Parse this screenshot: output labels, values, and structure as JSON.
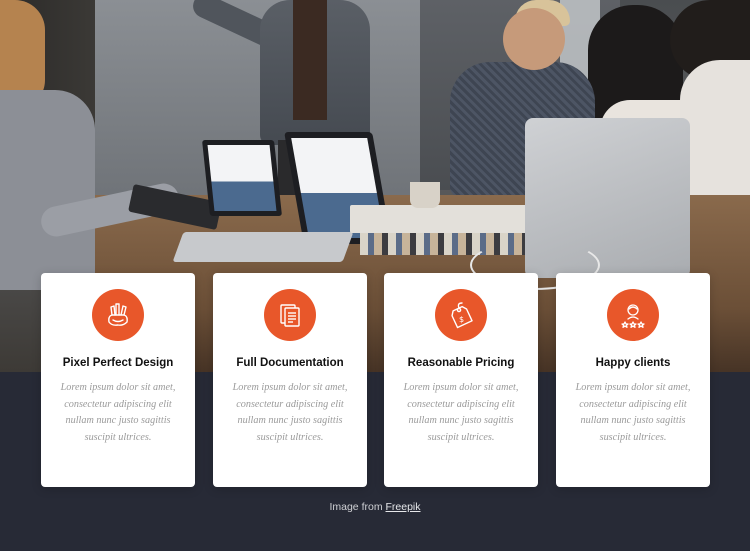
{
  "hero": {
    "icon": "meeting-photo"
  },
  "features": {
    "accent_color": "#e8572a",
    "items": [
      {
        "icon": "hand-pens-icon",
        "title": "Pixel Perfect Design",
        "text": "Lorem ipsum dolor sit amet, consectetur adipiscing elit nullam nunc justo sagittis suscipit ultrices."
      },
      {
        "icon": "documents-icon",
        "title": "Full Documentation",
        "text": "Lorem ipsum dolor sit amet, consectetur adipiscing elit nullam nunc justo sagittis suscipit ultrices."
      },
      {
        "icon": "price-tag-icon",
        "title": "Reasonable Pricing",
        "text": "Lorem ipsum dolor sit amet, consectetur adipiscing elit nullam nunc justo sagittis suscipit ultrices."
      },
      {
        "icon": "client-stars-icon",
        "title": "Happy clients",
        "text": "Lorem ipsum dolor sit amet, consectetur adipiscing elit nullam nunc justo sagittis suscipit ultrices."
      }
    ]
  },
  "credit": {
    "prefix": "Image from",
    "link_label": "Freepik"
  },
  "colors": {
    "background": "#272a36",
    "card": "#ffffff"
  }
}
